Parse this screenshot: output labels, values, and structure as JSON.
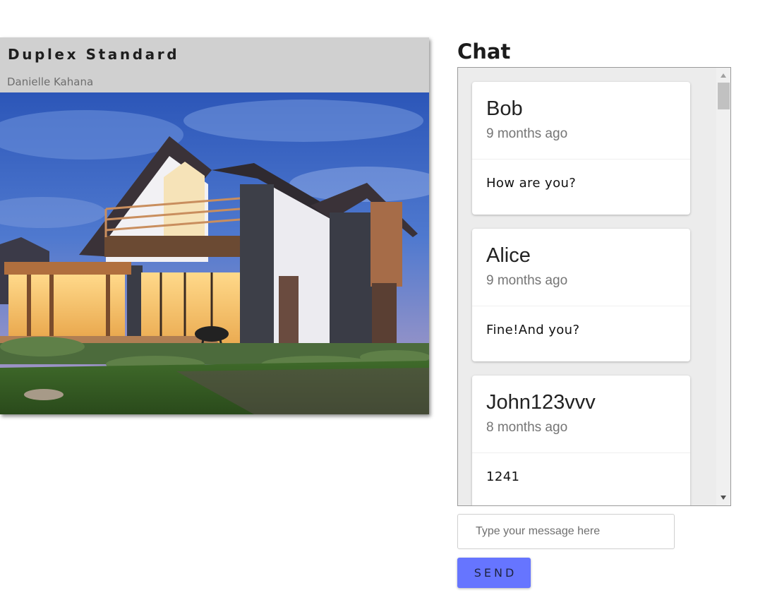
{
  "listing": {
    "title": "Duplex Standard",
    "owner": "Danielle Kahana",
    "photo_subject": "modern two-story duplex house at dusk"
  },
  "chat": {
    "heading": "Chat",
    "messages": [
      {
        "sender": "Bob",
        "time": "9 months ago",
        "text": "How are you?"
      },
      {
        "sender": "Alice",
        "time": "9 months ago",
        "text": "Fine!And you?"
      },
      {
        "sender": "John123vvv",
        "time": "8 months ago",
        "text": "1241"
      }
    ],
    "input": {
      "placeholder": "Type your message here",
      "value": ""
    },
    "send_label": "SEND"
  },
  "colors": {
    "send_button": "#6675ff",
    "chat_background": "#ececec",
    "listing_header": "#d0d0d0"
  },
  "icons": {
    "scroll_up": "scroll-up-arrow-icon",
    "scroll_down": "scroll-down-arrow-icon"
  }
}
